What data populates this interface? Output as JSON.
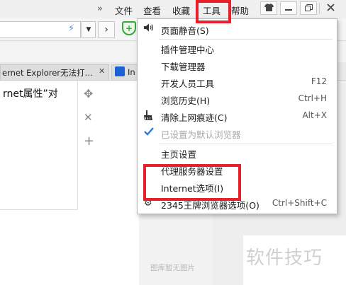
{
  "menubar": {
    "more": "»",
    "items": [
      "文件",
      "查看",
      "收藏",
      "工具",
      "帮助"
    ]
  },
  "window_buttons": [
    "shirt-icon",
    "minimize-icon",
    "restore-icon",
    "close-icon"
  ],
  "addressbar": {
    "value": "",
    "dropdown_glyph": "▼",
    "forward_glyph": "›"
  },
  "tabs": [
    {
      "label": "ernet Explorer无法打…",
      "close": "✕"
    },
    {
      "label": "In"
    }
  ],
  "page": {
    "text": "rnet属性”对",
    "no_image_text": "图库暂无图片",
    "watermark": "软件技巧"
  },
  "menu": {
    "items": [
      {
        "label": "页面静音(S)",
        "shortcut": "",
        "icon": "speaker-icon"
      },
      {
        "label": "插件管理中心",
        "shortcut": ""
      },
      {
        "label": "下载管理器",
        "shortcut": ""
      },
      {
        "label": "开发人员工具",
        "shortcut": "F12"
      },
      {
        "label": "浏览历史(H)",
        "shortcut": "Ctrl+H"
      },
      {
        "label": "清除上网痕迹(C)",
        "shortcut": "Alt+X",
        "icon": "broom-icon"
      },
      {
        "label": "已设置为默认浏览器",
        "shortcut": "",
        "icon": "check-icon",
        "disabled": true
      },
      {
        "label": "主页设置",
        "shortcut": ""
      },
      {
        "label": "代理服务器设置",
        "shortcut": ""
      },
      {
        "label": "Internet选项(I)",
        "shortcut": ""
      },
      {
        "label": "2345王牌浏览器选项(O)",
        "shortcut": "Ctrl+Shift+C"
      }
    ]
  },
  "colors": {
    "highlight": "#e8202a",
    "accent_blue": "#2b7bd6",
    "shield_green": "#3aa53a"
  }
}
